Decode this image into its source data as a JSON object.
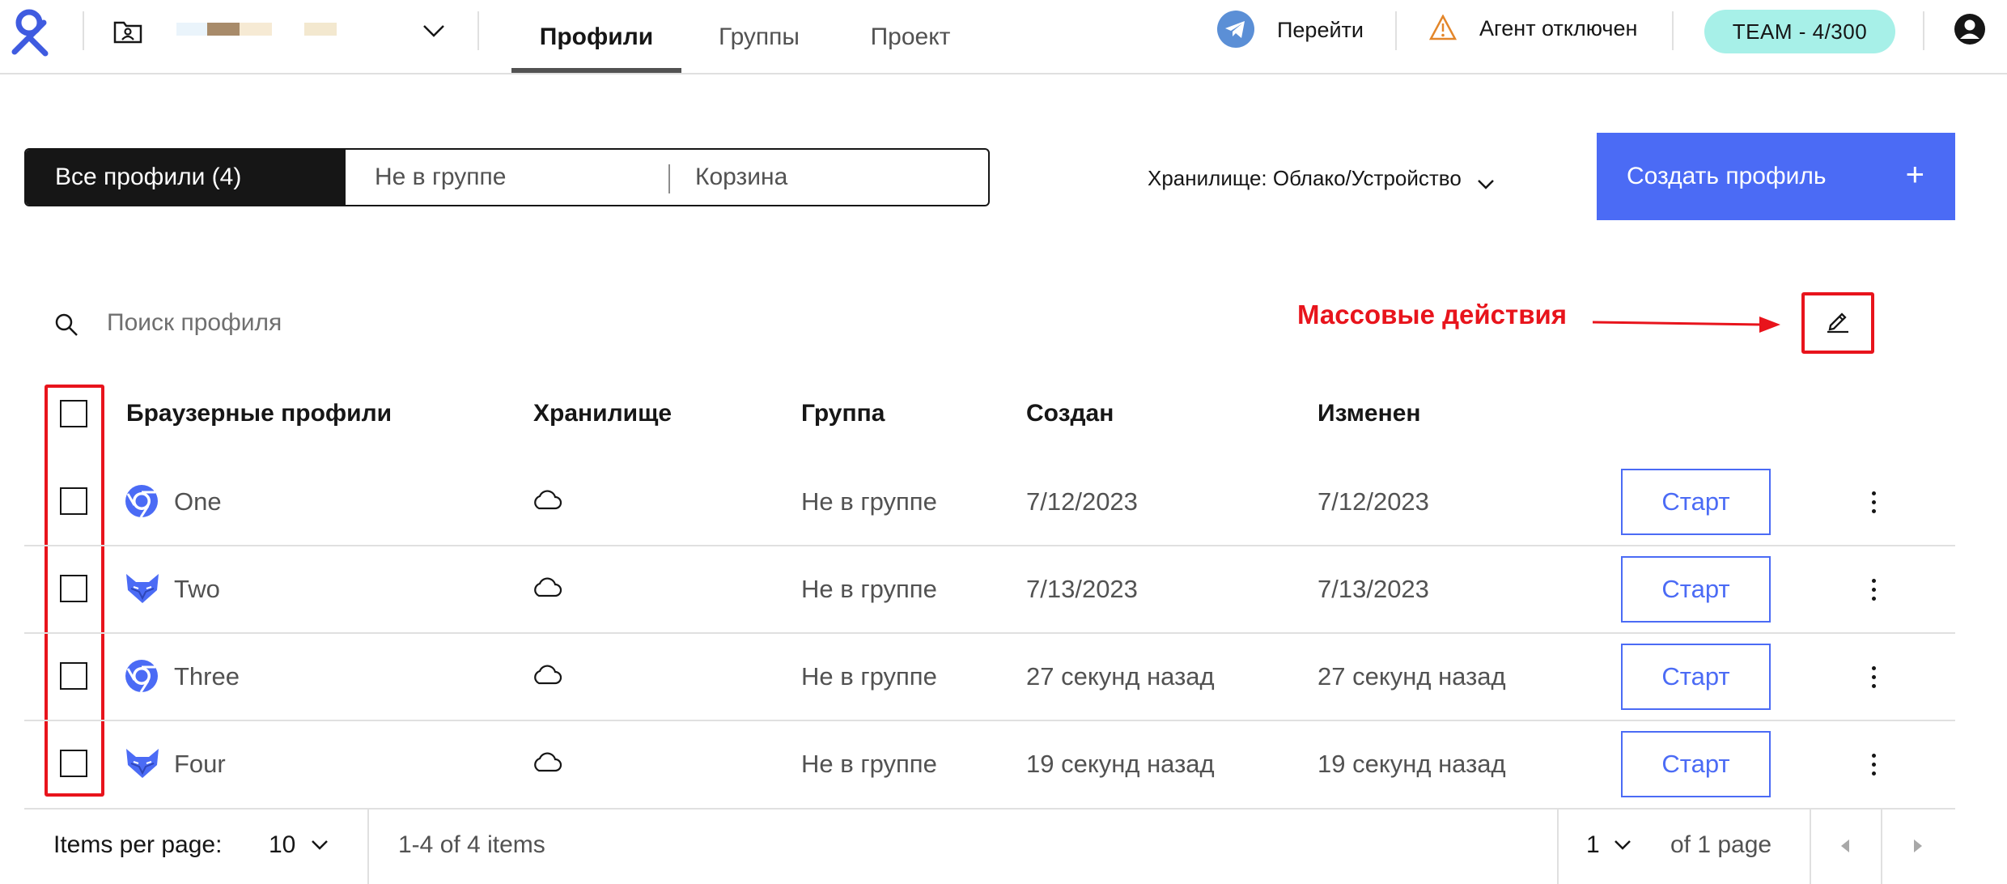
{
  "topbar": {
    "tabs": [
      {
        "label": "Профили",
        "active": true
      },
      {
        "label": "Группы",
        "active": false
      },
      {
        "label": "Проект",
        "active": false
      }
    ],
    "telegram_label": "Перейти",
    "agent_status": "Агент отключен",
    "plan_badge": "TEAM - 4/300"
  },
  "filters": {
    "items": [
      {
        "label": "Все профили (4)",
        "active": true
      },
      {
        "label": "Не в группе",
        "active": false
      },
      {
        "label": "Корзина",
        "active": false
      }
    ],
    "storage_label": "Хранилище: Облако/Устройство"
  },
  "create_button": {
    "label": "Создать профиль",
    "icon": "+"
  },
  "search": {
    "placeholder": "Поиск профиля"
  },
  "annotation": {
    "label": "Массовые действия",
    "color": "#e8141c"
  },
  "table": {
    "columns": [
      "Браузерные профили",
      "Хранилище",
      "Группа",
      "Создан",
      "Изменен"
    ],
    "start_label": "Старт",
    "rows": [
      {
        "name": "One",
        "browser_icon": "chrome-icon",
        "storage_icon": "cloud-icon",
        "group": "Не в группе",
        "created": "7/12/2023",
        "modified": "7/12/2023"
      },
      {
        "name": "Two",
        "browser_icon": "fox-icon",
        "storage_icon": "cloud-icon",
        "group": "Не в группе",
        "created": "7/13/2023",
        "modified": "7/13/2023"
      },
      {
        "name": "Three",
        "browser_icon": "chrome-icon",
        "storage_icon": "cloud-icon",
        "group": "Не в группе",
        "created": "27 секунд назад",
        "modified": "27 секунд назад"
      },
      {
        "name": "Four",
        "browser_icon": "fox-icon",
        "storage_icon": "cloud-icon",
        "group": "Не в группе",
        "created": "19 секунд назад",
        "modified": "19 секунд назад"
      }
    ]
  },
  "pagination": {
    "items_per_page_label": "Items per page:",
    "items_per_page": "10",
    "range_text": "1-4 of 4 items",
    "page": "1",
    "of_pages": "of 1 page"
  },
  "colors": {
    "accent": "#4b6bf5",
    "badge": "#a7f0e8",
    "annotation": "#e8141c",
    "dark": "#161616"
  }
}
